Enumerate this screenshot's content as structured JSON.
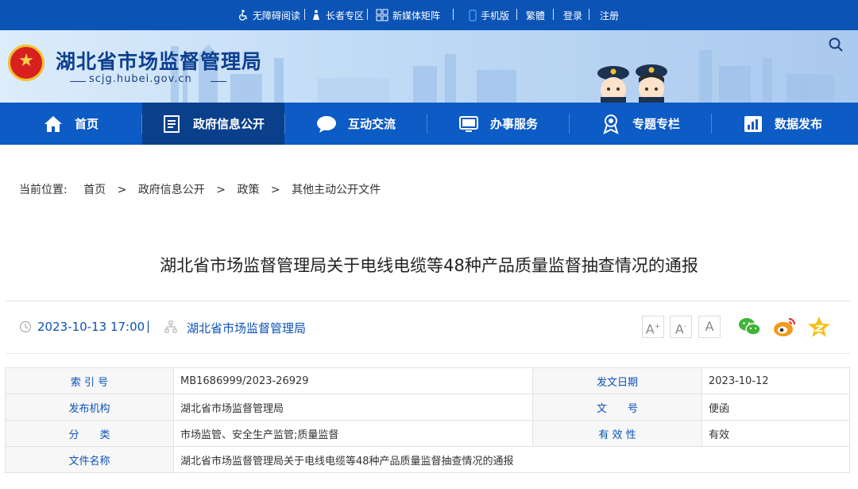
{
  "topbar": {
    "links": [
      "无障碍阅读",
      "长者专区",
      "新媒体矩阵",
      "手机版",
      "繁體",
      "登录",
      "注册"
    ]
  },
  "banner": {
    "site_title": "湖北省市场监督管理局",
    "domain": "scjg.hubei.gov.cn"
  },
  "nav": {
    "items": [
      {
        "label": "首页",
        "icon": "home-icon"
      },
      {
        "label": "政府信息公开",
        "icon": "document-icon"
      },
      {
        "label": "互动交流",
        "icon": "chat-icon"
      },
      {
        "label": "办事服务",
        "icon": "monitor-icon"
      },
      {
        "label": "专题专栏",
        "icon": "medal-icon"
      },
      {
        "label": "数据发布",
        "icon": "chart-icon"
      }
    ],
    "active_index": 1
  },
  "breadcrumb": {
    "prefix": "当前位置:",
    "items": [
      "首页",
      "政府信息公开",
      "政策",
      "其他主动公开文件"
    ],
    "separator": ">"
  },
  "article": {
    "title": "湖北省市场监督管理局关于电线电缆等48种产品质量监督抽查情况的通报",
    "datetime": "2023-10-13 17:00",
    "source": "湖北省市场监督管理局",
    "font_buttons": [
      "A",
      "A",
      "A"
    ]
  },
  "info_table": {
    "rows": [
      [
        {
          "label": "索 引 号",
          "value": "MB1686999/2023-26929"
        },
        {
          "label": "发文日期",
          "value": "2023-10-12"
        }
      ],
      [
        {
          "label": "发布机构",
          "value": "湖北省市场监督管理局"
        },
        {
          "label": "文　　号",
          "value": "便函"
        }
      ],
      [
        {
          "label": "分　　类",
          "value": "市场监管、安全生产监管;质量监督"
        },
        {
          "label": "有 效 性",
          "value": "有效"
        }
      ],
      [
        {
          "label": "文件名称",
          "value": "湖北省市场监督管理局关于电线电缆等48种产品质量监督抽查情况的通报"
        }
      ]
    ]
  },
  "colors": {
    "brand_blue": "#0c53b6",
    "nav_blue": "#0d5bc4",
    "nav_active": "#0a3f8c"
  }
}
